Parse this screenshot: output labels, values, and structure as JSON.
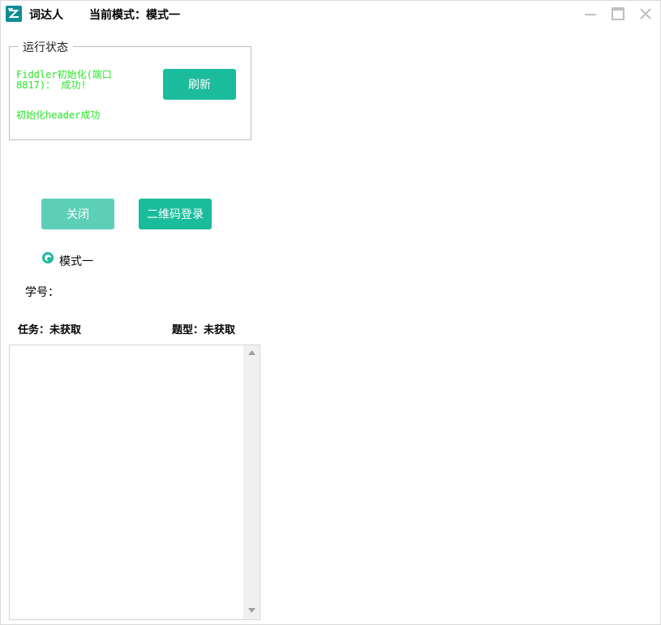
{
  "titlebar": {
    "app_name": "词达人",
    "mode_label": "当前模式：模式一"
  },
  "status_group": {
    "legend": "运行状态",
    "lines": [
      "Fiddler初始化(端口8817)： 成功!",
      "初始化header成功"
    ],
    "refresh_label": "刷新",
    "status_color": "#27e527"
  },
  "actions": {
    "close_label": "关闭",
    "qr_login_label": "二维码登录"
  },
  "mode_option": {
    "label": "模式一",
    "selected": true
  },
  "student": {
    "label": "学号："
  },
  "task": {
    "label": "任务：未获取"
  },
  "question_type": {
    "label": "题型：未获取"
  },
  "colors": {
    "accent": "#1abc9c",
    "accent_disabled": "#5ccfb6",
    "icon": "#0f8d96"
  }
}
